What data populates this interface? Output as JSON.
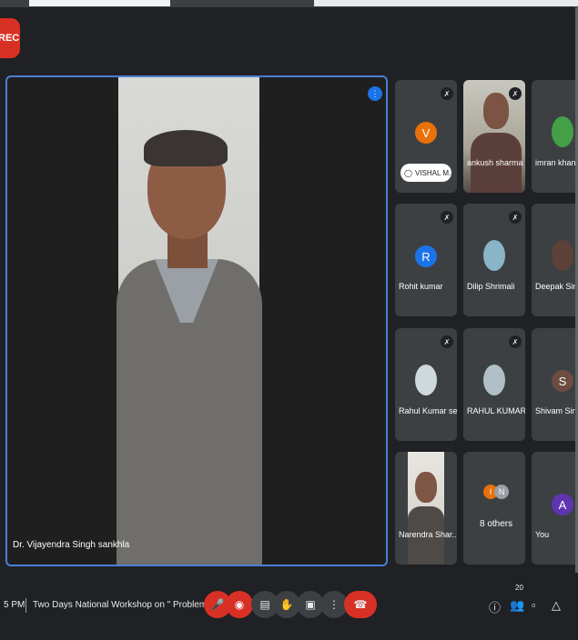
{
  "recording": {
    "label": "REC"
  },
  "main": {
    "participant_name": "Dr. Vijayendra Singh sankhla"
  },
  "tiles": [
    {
      "name": "VISHAL M...",
      "initial": "V",
      "color": "#e8710a",
      "muted": true,
      "type": "avatar"
    },
    {
      "name": "ankush sharma",
      "muted": true,
      "type": "video"
    },
    {
      "name": "imran khan",
      "muted": false,
      "type": "photo"
    },
    {
      "name": "Rohit kumar",
      "initial": "R",
      "color": "#1a73e8",
      "muted": true,
      "type": "avatar"
    },
    {
      "name": "Dilip Shrimali",
      "muted": true,
      "type": "photo"
    },
    {
      "name": "Deepak Singh",
      "muted": false,
      "type": "photo"
    },
    {
      "name": "Rahul Kumar sen",
      "muted": true,
      "type": "photo"
    },
    {
      "name": "RAHUL KUMAR",
      "muted": true,
      "type": "photo"
    },
    {
      "name": "Shivam Singh",
      "initial": "S",
      "color": "#6d4c41",
      "muted": false,
      "type": "avatar"
    },
    {
      "name": "Narendra Shar...",
      "muted": false,
      "type": "video"
    },
    {
      "name": "8 others",
      "initials": [
        "I",
        "N"
      ],
      "muted": false,
      "type": "group"
    },
    {
      "name": "You",
      "initial": "A",
      "color": "#5e35b1",
      "muted": false,
      "type": "avatar"
    }
  ],
  "bottombar": {
    "time": "5 PM",
    "meeting_title": "Two Days National Workshop on \" Problem ...",
    "participant_count": "20"
  }
}
